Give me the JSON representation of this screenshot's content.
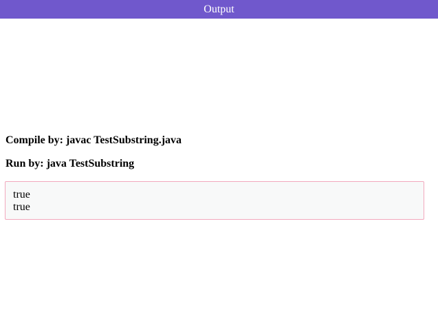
{
  "header": {
    "title": "Output",
    "color": "#7058cc"
  },
  "main": {
    "compile_command": "Compile by: javac TestSubstring.java",
    "run_command": "Run by: java TestSubstring",
    "output_lines": [
      "true",
      "true"
    ],
    "output_border_color": "#f2a8bd"
  }
}
